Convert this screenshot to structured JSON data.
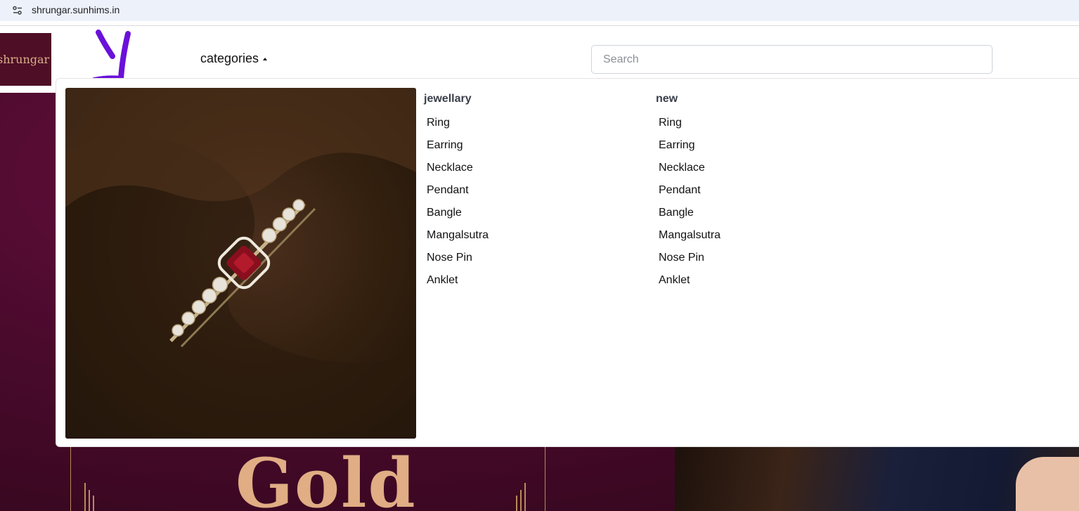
{
  "browser": {
    "url": "shrungar.sunhims.in",
    "site_info_icon": "tune-icon"
  },
  "header": {
    "logo_text": "shrungar",
    "categories_label": "categories",
    "categories_caret_icon": "caret-up-icon"
  },
  "search": {
    "placeholder": "Search",
    "value": ""
  },
  "menu": {
    "columns": [
      {
        "heading": "jewellary",
        "items": [
          "Ring",
          "Earring",
          "Necklace",
          "Pendant",
          "Bangle",
          "Mangalsutra",
          "Nose Pin",
          "Anklet"
        ]
      },
      {
        "heading": "new",
        "items": [
          "Ring",
          "Earring",
          "Necklace",
          "Pendant",
          "Bangle",
          "Mangalsutra",
          "Nose Pin",
          "Anklet"
        ]
      }
    ]
  },
  "hero": {
    "title": "Gold"
  },
  "colors": {
    "brand_maroon": "#4e0e26",
    "logo_gold": "#d9b08a",
    "annotation_purple": "#6a11d9"
  }
}
